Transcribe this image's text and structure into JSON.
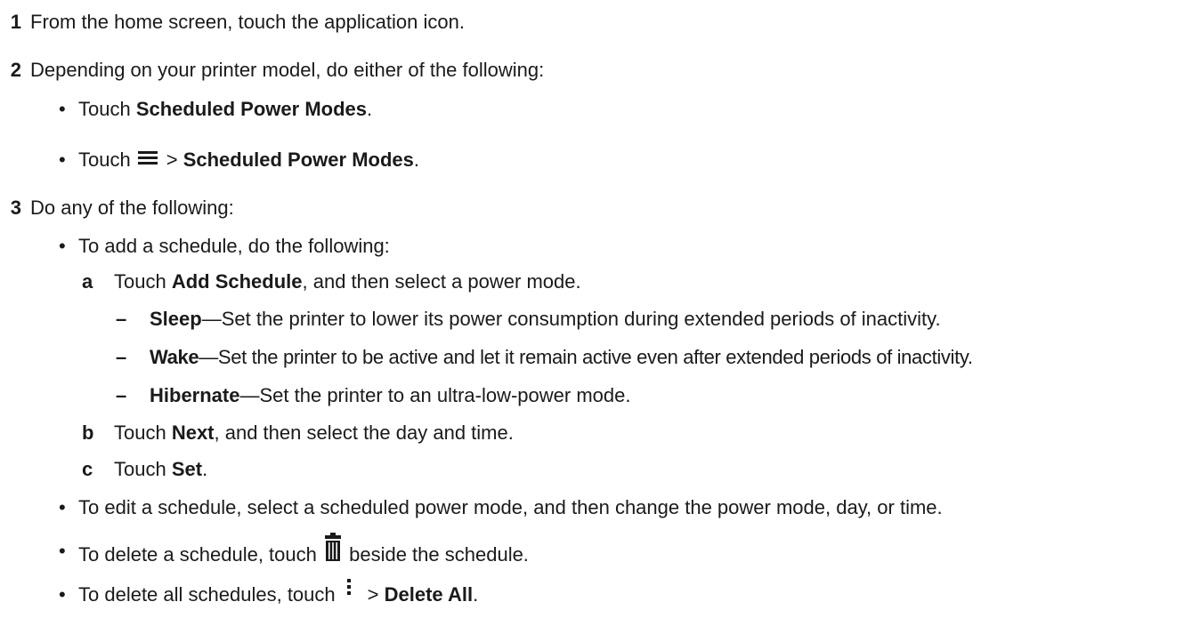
{
  "steps": [
    {
      "num": "1",
      "text": "From the home screen, touch the application icon."
    },
    {
      "num": "2",
      "text": "Depending on your printer model, do either of the following:"
    },
    {
      "num": "3",
      "text": "Do any of the following:"
    }
  ],
  "step2_bullets": {
    "b1": {
      "pre": "Touch ",
      "bold": "Scheduled Power Modes",
      "post": "."
    },
    "b2": {
      "pre": "Touch",
      "sep": ">",
      "bold": "Scheduled Power Modes",
      "post": "."
    }
  },
  "step3": {
    "add": {
      "text": "To add a schedule, do the following:"
    },
    "a": {
      "letter": "a",
      "pre": "Touch ",
      "bold": "Add Schedule",
      "post": ", and then select a power mode."
    },
    "modes": [
      {
        "dash": "–",
        "bold": "Sleep",
        "desc": "—Set the printer to lower its power consumption during extended periods of inactivity."
      },
      {
        "dash": "–",
        "bold": "Wake",
        "desc": "—Set the printer to be active and let it remain active even after extended periods of inactivity."
      },
      {
        "dash": "–",
        "bold": "Hibernate",
        "desc": "—Set the printer to an ultra-low-power mode."
      }
    ],
    "b": {
      "letter": "b",
      "pre": "Touch ",
      "bold": "Next",
      "post": ", and then select the day and time."
    },
    "c": {
      "letter": "c",
      "pre": "Touch ",
      "bold": "Set",
      "post": "."
    },
    "edit": {
      "text": "To edit a schedule, select a scheduled power mode, and then change the power mode, day, or time."
    },
    "delete": {
      "pre": "To delete a schedule, touch",
      "post": "beside the schedule."
    },
    "delete_all": {
      "pre": "To delete all schedules, touch",
      "sep": ">",
      "bold": "Delete All",
      "post": "."
    }
  },
  "bullet_char": "•",
  "icons": [
    "menu-icon",
    "trash-icon",
    "more-vertical-icon"
  ]
}
